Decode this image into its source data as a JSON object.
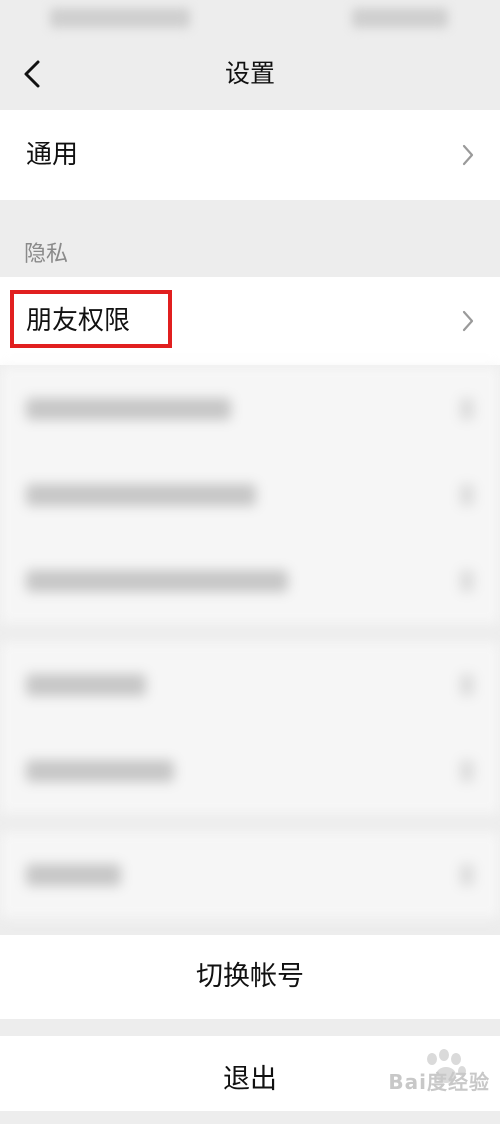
{
  "nav": {
    "title": "设置"
  },
  "general": {
    "label": "通用"
  },
  "privacy": {
    "section_label": "隐私",
    "friend_permissions_label": "朋友权限"
  },
  "actions": {
    "switch_account": "切换帐号",
    "logout": "退出"
  },
  "watermark": {
    "text": "Bai度经验"
  },
  "colors": {
    "highlight": "#e11f1f",
    "background": "#ededed",
    "cell": "#ffffff"
  },
  "icons": {
    "back": "chevron-left-icon",
    "disclosure": "chevron-right-icon"
  }
}
